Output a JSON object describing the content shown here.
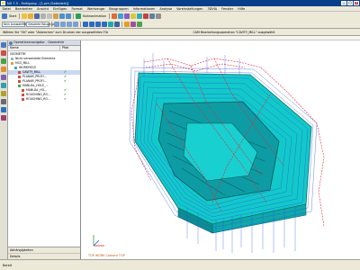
{
  "window": {
    "title": "NX 7.5 - Fertigung - [1.prt (Geändert)]",
    "min": "_",
    "max": "□",
    "close": "x"
  },
  "menu": [
    "Datei",
    "Bearbeiten",
    "Ansicht",
    "Einfügen",
    "Format",
    "Werkzeuge",
    "Baugruppen",
    "Informationen",
    "Analyse",
    "Voreinstellungen",
    "3DVIA",
    "Fenster",
    "Hilfe"
  ],
  "toolbar": {
    "start_label": "Start",
    "cam_label": "Bahnanimation",
    "selection_filter": "Kein Auswahlfilter",
    "scope": "Gesamte Baugruppe"
  },
  "cue": {
    "left": "Wählen Sie \"OK\" oder \"Abbrechen\" zum Drucken der ausgewählten Flächen aus",
    "right": "CAM Bearbeitungsoperation \"CAVITY_MILL\" ausgewählt"
  },
  "navigator": {
    "title": "Operationsnavigator - Geometrie",
    "col_name": "Name",
    "col_path": "Pfad",
    "items": [
      {
        "label": "GEOMETRY",
        "check": ""
      },
      {
        "label": "Nicht verwendete Elemente",
        "check": ""
      },
      {
        "label": "MCS_MILL",
        "check": ""
      },
      {
        "label": "WORKPIECE",
        "check": ""
      },
      {
        "label": "CAVITY_MILL",
        "check": "✔"
      },
      {
        "label": "PLANAR_PROFI...",
        "check": "✔"
      },
      {
        "label": "PLANAR_PROFI...",
        "check": "✔"
      },
      {
        "label": "MANUAL_HOLE_...",
        "check": ""
      },
      {
        "label": "MANUAL_HO...",
        "check": "✔"
      },
      {
        "label": "ROUGHING_RO...",
        "check": "✔"
      },
      {
        "label": "ROUGHING_RO...",
        "check": "✔"
      }
    ],
    "bottom": [
      "Abhängigkeiten",
      "Details"
    ]
  },
  "viewport": {
    "view_label": "TOP  WORK  Camera TOP"
  },
  "status": {
    "text": "Bereit"
  },
  "colors": {
    "part": "#10c8c8",
    "part_dark": "#0a7070",
    "toolpath_blue": "#2a55e6",
    "toolpath_red": "#e0283c",
    "title_blue": "#06408a"
  }
}
